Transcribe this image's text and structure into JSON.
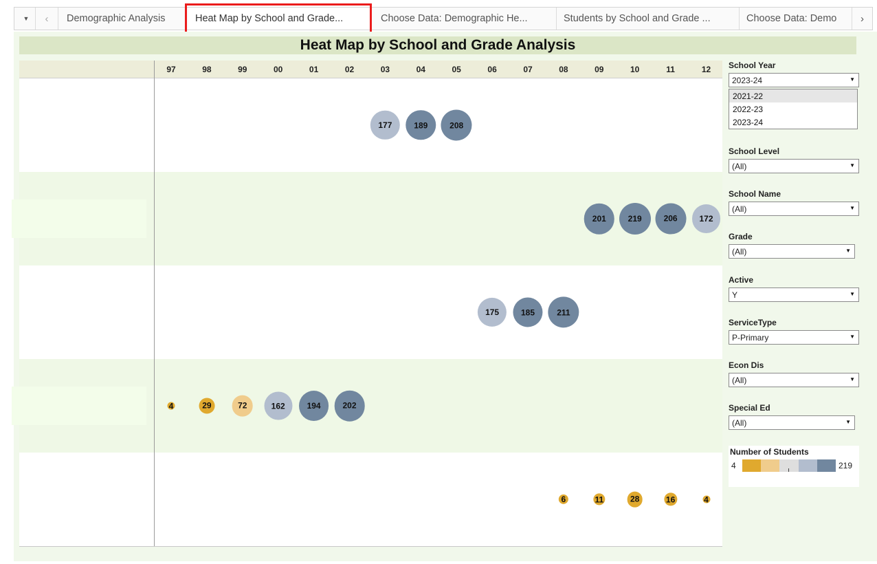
{
  "tabs": {
    "items": [
      {
        "label": "Demographic Analysis"
      },
      {
        "label": "Heat Map by School and Grade..."
      },
      {
        "label": "Choose Data: Demographic He..."
      },
      {
        "label": "Students by School and Grade ..."
      },
      {
        "label": "Choose Data: Demo"
      }
    ],
    "active_index": 1,
    "dropdown_icon": "▼",
    "prev_icon": "‹",
    "next_icon": "›"
  },
  "dashboard": {
    "title": "Heat Map by School and Grade Analysis"
  },
  "chart_data": {
    "type": "heatmap",
    "title": "Heat Map by School and Grade Analysis",
    "x_categories": [
      "97",
      "98",
      "99",
      "00",
      "01",
      "02",
      "03",
      "04",
      "05",
      "06",
      "07",
      "08",
      "09",
      "10",
      "11",
      "12"
    ],
    "rows": [
      {
        "cells": [
          {
            "x": "03",
            "value": 177
          },
          {
            "x": "04",
            "value": 189
          },
          {
            "x": "05",
            "value": 208
          }
        ]
      },
      {
        "cells": [
          {
            "x": "09",
            "value": 201
          },
          {
            "x": "10",
            "value": 219
          },
          {
            "x": "11",
            "value": 206
          },
          {
            "x": "12",
            "value": 172
          }
        ]
      },
      {
        "cells": [
          {
            "x": "06",
            "value": 175
          },
          {
            "x": "07",
            "value": 185
          },
          {
            "x": "08",
            "value": 211
          }
        ]
      },
      {
        "cells": [
          {
            "x": "97",
            "value": 4
          },
          {
            "x": "98",
            "value": 29
          },
          {
            "x": "99",
            "value": 72
          },
          {
            "x": "00",
            "value": 162
          },
          {
            "x": "01",
            "value": 194
          },
          {
            "x": "02",
            "value": 202
          }
        ]
      },
      {
        "cells": [
          {
            "x": "08",
            "value": 6
          },
          {
            "x": "09",
            "value": 11
          },
          {
            "x": "10",
            "value": 28
          },
          {
            "x": "11",
            "value": 16
          },
          {
            "x": "12",
            "value": 4
          }
        ]
      }
    ],
    "color_scale": {
      "min": 4,
      "max": 219,
      "colors": [
        "#e0a92e",
        "#f0cc8c",
        "#dedede",
        "#b2bdce",
        "#71879f"
      ]
    }
  },
  "filters": {
    "school_year": {
      "label": "School Year",
      "value": "2023-24",
      "options": [
        "2021-22",
        "2022-23",
        "2023-24"
      ]
    },
    "school_level": {
      "label": "School Level",
      "value": "(All)"
    },
    "school_name": {
      "label": "School Name",
      "value": "(All)"
    },
    "grade": {
      "label": "Grade",
      "value": "(All)"
    },
    "active": {
      "label": "Active",
      "value": "Y"
    },
    "service_type": {
      "label": "ServiceType",
      "value": "P-Primary"
    },
    "econ_dis": {
      "label": "Econ Dis",
      "value": "(All)"
    },
    "special_ed": {
      "label": "Special Ed",
      "value": "(All)"
    }
  },
  "legend": {
    "title": "Number of Students",
    "min_label": "4",
    "max_label": "219",
    "colors": [
      "#e0a92e",
      "#f0cc8c",
      "#dedede",
      "#b2bdce",
      "#71879f"
    ]
  },
  "icons": {
    "select_arrow": "▼"
  }
}
